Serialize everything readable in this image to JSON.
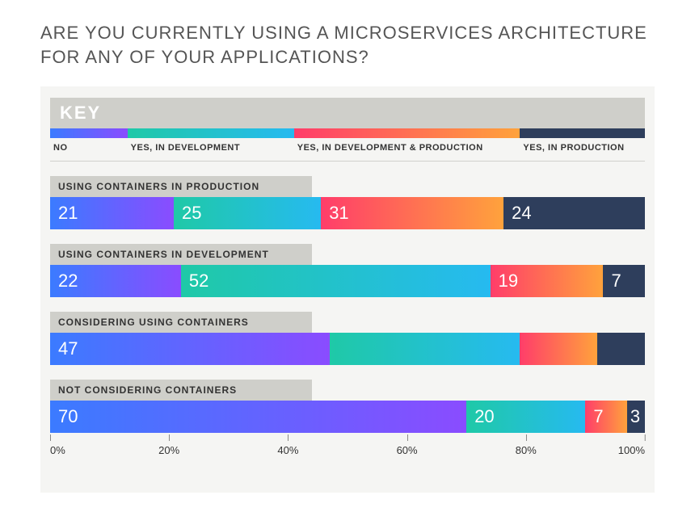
{
  "title": "ARE YOU CURRENTLY USING A MICROSERVICES ARCHITECTURE FOR ANY OF YOUR APPLICATIONS?",
  "key_header": "KEY",
  "axis": [
    "0%",
    "20%",
    "40%",
    "60%",
    "80%",
    "100%"
  ],
  "legend": [
    {
      "label": "NO",
      "width": 13
    },
    {
      "label": "YES, IN DEVELOPMENT",
      "width": 28
    },
    {
      "label": "YES, IN DEVELOPMENT & PRODUCTION",
      "width": 38
    },
    {
      "label": "YES, IN PRODUCTION",
      "width": 21
    }
  ],
  "gradients": {
    "no": [
      "#3b7bff",
      "#8a4cff"
    ],
    "dev": [
      "#1fc9a7",
      "#26baf0"
    ],
    "devprod": [
      "#ff3d6a",
      "#ffa23c"
    ],
    "prod": [
      "#2e3e5c",
      "#2e3e5c"
    ]
  },
  "chart_data": {
    "type": "bar",
    "title": "ARE YOU CURRENTLY USING A MICROSERVICES ARCHITECTURE FOR ANY OF YOUR APPLICATIONS?",
    "xlabel": "",
    "ylabel": "",
    "xlim": [
      0,
      100
    ],
    "categories": [
      "USING CONTAINERS IN PRODUCTION",
      "USING CONTAINERS IN DEVELOPMENT",
      "CONSIDERING USING CONTAINERS",
      "NOT CONSIDERING CONTAINERS"
    ],
    "series": [
      {
        "name": "NO",
        "values": [
          21,
          22,
          47,
          70
        ]
      },
      {
        "name": "YES, IN DEVELOPMENT",
        "values": [
          25,
          52,
          32,
          20
        ]
      },
      {
        "name": "YES, IN DEVELOPMENT & PRODUCTION",
        "values": [
          31,
          19,
          13,
          7
        ]
      },
      {
        "name": "YES, IN PRODUCTION",
        "values": [
          24,
          7,
          8,
          3
        ]
      }
    ],
    "value_labels": [
      [
        "21",
        "25",
        "31",
        "24"
      ],
      [
        "22",
        "52",
        "19",
        "7"
      ],
      [
        "47",
        "",
        "",
        ""
      ],
      [
        "70",
        "20",
        "7",
        "3"
      ]
    ]
  }
}
